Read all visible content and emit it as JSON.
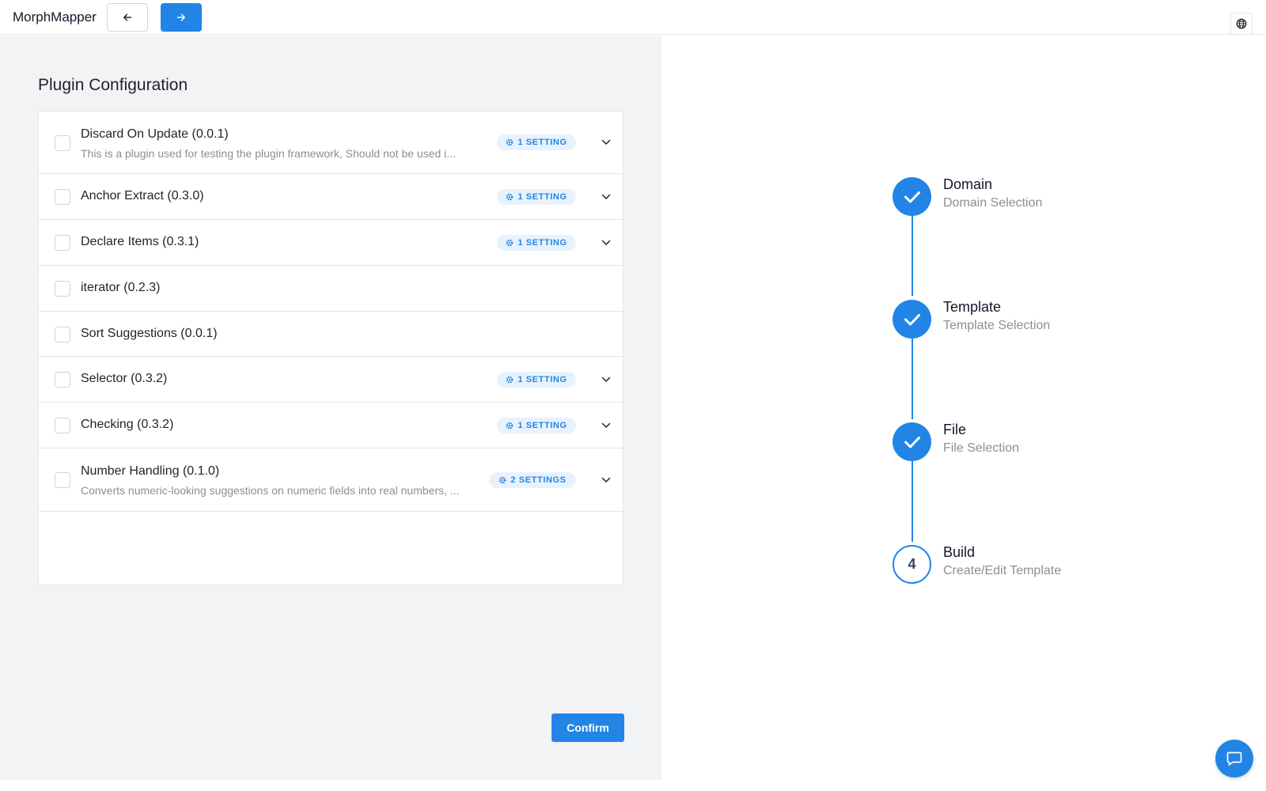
{
  "app": {
    "title": "MorphMapper"
  },
  "header": {
    "back_icon": "arrow-left-icon",
    "forward_icon": "arrow-right-icon",
    "language_icon": "globe-icon"
  },
  "main": {
    "section_title": "Plugin Configuration",
    "plugins": [
      {
        "title": "Discard On Update (0.0.1)",
        "description": "This is a plugin used for testing the plugin framework, Should not be used i...",
        "badge": "1 SETTING",
        "checked": false
      },
      {
        "title": "Anchor Extract (0.3.0)",
        "description": "",
        "badge": "1 SETTING",
        "checked": false
      },
      {
        "title": "Declare Items (0.3.1)",
        "description": "",
        "badge": "1 SETTING",
        "checked": false
      },
      {
        "title": "iterator (0.2.3)",
        "description": "",
        "badge": "",
        "checked": false
      },
      {
        "title": "Sort Suggestions (0.0.1)",
        "description": "",
        "badge": "",
        "checked": false
      },
      {
        "title": "Selector (0.3.2)",
        "description": "",
        "badge": "1 SETTING",
        "checked": false
      },
      {
        "title": "Checking (0.3.2)",
        "description": "",
        "badge": "1 SETTING",
        "checked": false
      },
      {
        "title": "Number Handling (0.1.0)",
        "description": "Converts numeric-looking suggestions on numeric fields into real numbers, ...",
        "badge": "2 SETTINGS",
        "checked": false
      }
    ],
    "confirm_label": "Confirm"
  },
  "stepper": {
    "steps": [
      {
        "title": "Domain",
        "subtitle": "Domain Selection",
        "status": "done"
      },
      {
        "title": "Template",
        "subtitle": "Template Selection",
        "status": "done"
      },
      {
        "title": "File",
        "subtitle": "File Selection",
        "status": "done"
      },
      {
        "title": "Build",
        "subtitle": "Create/Edit Template",
        "status": "current",
        "number": "4"
      }
    ]
  },
  "colors": {
    "accent": "#2285e6",
    "panel_bg": "#f2f3f5",
    "badge_bg": "#e8f2fc"
  },
  "chat": {
    "icon": "chat-bubble-icon"
  }
}
